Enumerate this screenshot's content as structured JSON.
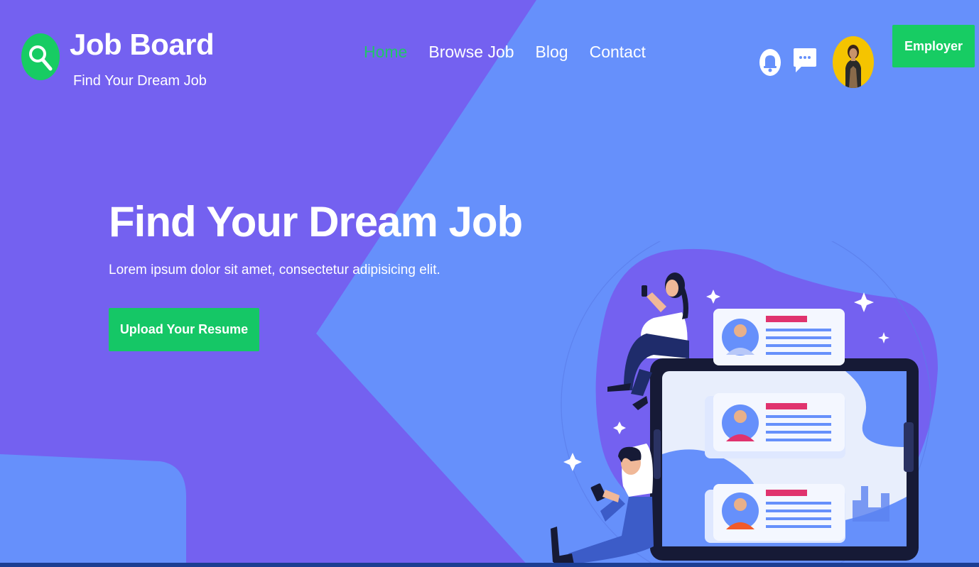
{
  "brand": {
    "title": "Job Board",
    "subtitle": "Find Your Dream Job"
  },
  "nav": {
    "items": [
      {
        "label": "Home",
        "active": true
      },
      {
        "label": "Browse Job",
        "active": false
      },
      {
        "label": "Blog",
        "active": false
      },
      {
        "label": "Contact",
        "active": false
      }
    ]
  },
  "header": {
    "icons": [
      "bell-icon",
      "chat-icon"
    ],
    "employer_label": "Employer"
  },
  "hero": {
    "title": "Find Your Dream Job",
    "subtitle": "Lorem ipsum dolor sit amet, consectetur adipisicing elit.",
    "cta_label": "Upload Your Resume"
  },
  "colors": {
    "purple_bg": "#7461f0",
    "blue_bg": "#6690fb",
    "accent_green": "#17cc63",
    "active_nav": "#21c46a"
  }
}
